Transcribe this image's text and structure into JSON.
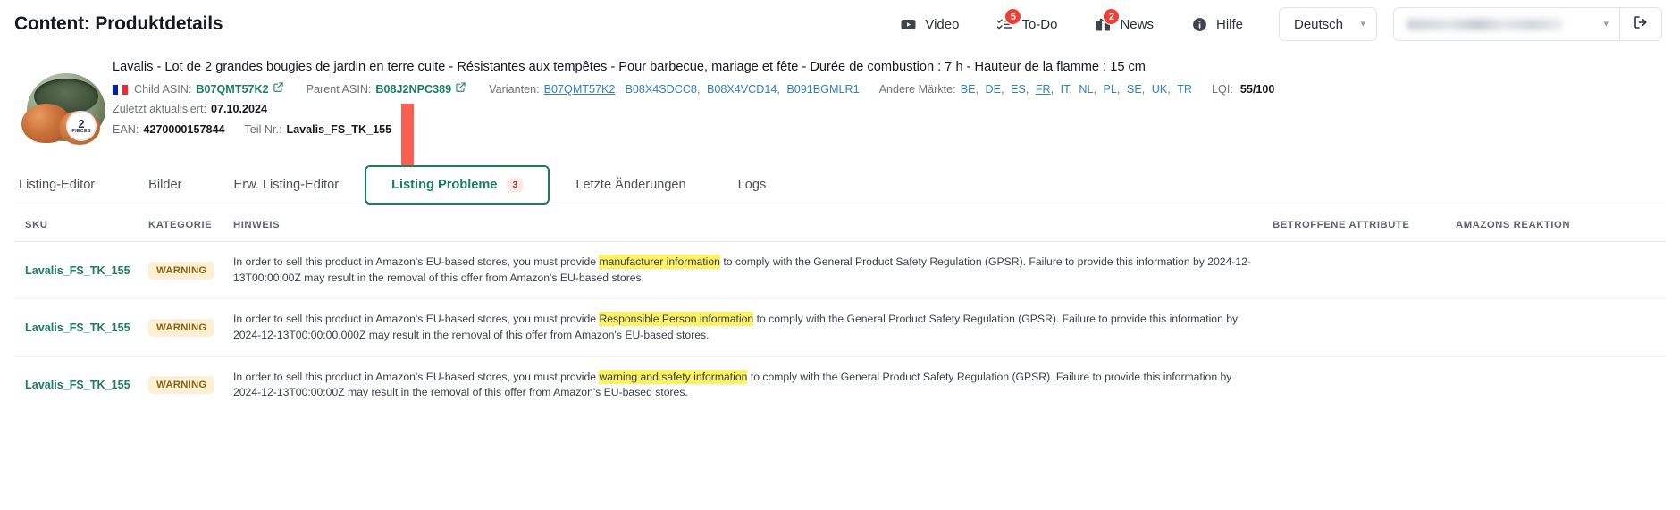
{
  "header": {
    "title": "Content: Produktdetails",
    "nav": [
      {
        "label": "Video",
        "icon": "video-icon",
        "badge": null
      },
      {
        "label": "To-Do",
        "icon": "todo-list-icon",
        "badge": "5"
      },
      {
        "label": "News",
        "icon": "gift-icon",
        "badge": "2"
      },
      {
        "label": "Hilfe",
        "icon": "info-icon",
        "badge": null
      }
    ],
    "language_select": {
      "value": "Deutsch",
      "chevron": "chevron-down-icon"
    },
    "account_select": {
      "value": "",
      "redacted": true,
      "chevron": "chevron-down-icon"
    },
    "logout": {
      "icon": "logout-icon",
      "label": ""
    }
  },
  "product": {
    "title": "Lavalis - Lot de 2 grandes bougies de jardin en terre cuite - Résistantes aux tempêtes - Pour barbecue, mariage et fête - Durée de combustion : 7 h - Hauteur de la flamme : 15 cm",
    "thumbnail": {
      "badge_number": "2",
      "badge_word": "PIECES"
    },
    "flag": "fr-flag-icon",
    "child_asin_label": "Child ASIN:",
    "child_asin": "B07QMT57K2",
    "parent_asin_label": "Parent ASIN:",
    "parent_asin": "B08J2NPC389",
    "variants_label": "Varianten:",
    "variants": [
      "B07QMT57K2",
      "B08X4SDCC8",
      "B08X4VCD14",
      "B091BGMLR1"
    ],
    "variants_active": "B07QMT57K2",
    "markets_label": "Andere Märkte:",
    "markets": [
      "BE",
      "DE",
      "ES",
      "FR",
      "IT",
      "NL",
      "PL",
      "SE",
      "UK",
      "TR"
    ],
    "markets_active": "FR",
    "lqi_label": "LQI:",
    "lqi_value": "55/100",
    "updated_label": "Zuletzt aktualisiert:",
    "updated_value": "07.10.2024",
    "ean_label": "EAN:",
    "ean_value": "4270000157844",
    "part_label": "Teil Nr.:",
    "part_value": "Lavalis_FS_TK_155"
  },
  "annotation": {
    "arrow_color": "#f9604f",
    "points_to": "Listing Probleme"
  },
  "tabs": [
    {
      "label": "Listing-Editor",
      "active": false,
      "badge": null
    },
    {
      "label": "Bilder",
      "active": false,
      "badge": null
    },
    {
      "label": "Erw. Listing-Editor",
      "active": false,
      "badge": null
    },
    {
      "label": "Listing Probleme",
      "active": true,
      "badge": "3"
    },
    {
      "label": "Letzte Änderungen",
      "active": false,
      "badge": null
    },
    {
      "label": "Logs",
      "active": false,
      "badge": null
    }
  ],
  "table": {
    "columns": [
      "SKU",
      "KATEGORIE",
      "HINWEIS",
      "BETROFFENE ATTRIBUTE",
      "AMAZONS REAKTION"
    ],
    "rows": [
      {
        "sku": "Lavalis_FS_TK_155",
        "kategorie": "WARNING",
        "hinweis_pre": "In order to sell this product in Amazon's EU-based stores, you must provide ",
        "hinweis_mark": "manufacturer information",
        "hinweis_post": " to comply with the General Product Safety Regulation (GPSR). Failure to provide this information by 2024-12-13T00:00:00Z may result in the removal of this offer from Amazon's EU-based stores.",
        "attribute": "",
        "reaktion": ""
      },
      {
        "sku": "Lavalis_FS_TK_155",
        "kategorie": "WARNING",
        "hinweis_pre": "In order to sell this product in Amazon's EU-based stores, you must provide ",
        "hinweis_mark": "Responsible Person information",
        "hinweis_post": " to comply with the General Product Safety Regulation (GPSR). Failure to provide this information by 2024-12-13T00:00:00.000Z may result in the removal of this offer from Amazon's EU-based stores.",
        "attribute": "",
        "reaktion": ""
      },
      {
        "sku": "Lavalis_FS_TK_155",
        "kategorie": "WARNING",
        "hinweis_pre": "In order to sell this product in Amazon's EU-based stores, you must provide ",
        "hinweis_mark": "warning and safety information",
        "hinweis_post": " to comply with the General Product Safety Regulation (GPSR). Failure to provide this information by 2024-12-13T00:00:00Z may result in the removal of this offer from Amazon's EU-based stores.",
        "attribute": "",
        "reaktion": ""
      }
    ]
  },
  "colors": {
    "accent_green": "#1a7f5a",
    "link_blue": "#2f80c2",
    "badge_red": "#ef3e36",
    "warning_bg": "#fcefd4",
    "warning_fg": "#8a6516",
    "highlight": "#fdf264",
    "arrow": "#f9604f"
  }
}
